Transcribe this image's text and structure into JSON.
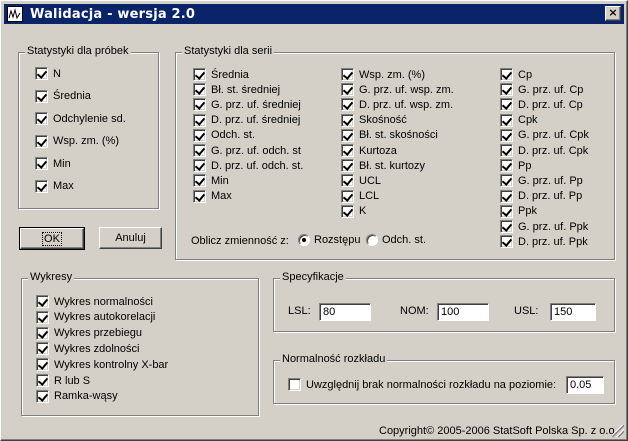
{
  "window": {
    "title": "Walidacja - wersja 2.0",
    "close_label": "×"
  },
  "sample_stats": {
    "legend": "Statystyki dla próbek",
    "items": [
      {
        "label": "N",
        "checked": true
      },
      {
        "label": "Średnia",
        "checked": true
      },
      {
        "label": "Odchylenie sd.",
        "checked": true
      },
      {
        "label": "Wsp. zm. (%)",
        "checked": true
      },
      {
        "label": "Min",
        "checked": true
      },
      {
        "label": "Max",
        "checked": true
      }
    ]
  },
  "series_stats": {
    "legend": "Statystyki dla serii",
    "col1": [
      {
        "label": "Średnia",
        "checked": true
      },
      {
        "label": "Bł. st. średniej",
        "checked": true
      },
      {
        "label": "G. prz. uf. średniej",
        "checked": true
      },
      {
        "label": "D. prz. uf. średniej",
        "checked": true
      },
      {
        "label": "Odch. st.",
        "checked": true
      },
      {
        "label": "G. prz. uf. odch. st",
        "checked": true
      },
      {
        "label": "D. prz. uf. odch. st.",
        "checked": true
      },
      {
        "label": "Min",
        "checked": true
      },
      {
        "label": "Max",
        "checked": true
      }
    ],
    "col2": [
      {
        "label": "Wsp. zm. (%)",
        "checked": true
      },
      {
        "label": "G. prz. uf. wsp. zm.",
        "checked": true
      },
      {
        "label": "D. prz. uf. wsp. zm.",
        "checked": true
      },
      {
        "label": "Skośność",
        "checked": true
      },
      {
        "label": "Bł. st. skośności",
        "checked": true
      },
      {
        "label": "Kurtoza",
        "checked": true
      },
      {
        "label": "Bł. st. kurtozy",
        "checked": true
      },
      {
        "label": "UCL",
        "checked": true
      },
      {
        "label": "LCL",
        "checked": true
      },
      {
        "label": "K",
        "checked": true
      }
    ],
    "col3": [
      {
        "label": "Cp",
        "checked": true
      },
      {
        "label": "G. prz. uf. Cp",
        "checked": true
      },
      {
        "label": "D. prz. uf. Cp",
        "checked": true
      },
      {
        "label": "Cpk",
        "checked": true
      },
      {
        "label": "G. prz. uf. Cpk",
        "checked": true
      },
      {
        "label": "D. prz. uf. Cpk",
        "checked": true
      },
      {
        "label": "Pp",
        "checked": true
      },
      {
        "label": "G. prz. uf. Pp",
        "checked": true
      },
      {
        "label": "D. prz. uf. Pp",
        "checked": true
      },
      {
        "label": "Ppk",
        "checked": true
      },
      {
        "label": "G. prz. uf. Ppk",
        "checked": true
      },
      {
        "label": "D. prz. uf. Ppk",
        "checked": true
      }
    ],
    "variability_label": "Oblicz zmienność z:",
    "variability_options": [
      {
        "label": "Rozstępu",
        "selected": true
      },
      {
        "label": "Odch. st.",
        "selected": false
      }
    ]
  },
  "buttons": {
    "ok": "OK",
    "cancel": "Anuluj"
  },
  "charts": {
    "legend": "Wykresy",
    "items": [
      {
        "label": "Wykres normalności",
        "checked": true
      },
      {
        "label": "Wykres autokorelacji",
        "checked": true
      },
      {
        "label": "Wykres przebiegu",
        "checked": true
      },
      {
        "label": "Wykres zdolności",
        "checked": true
      },
      {
        "label": "Wykres kontrolny X-bar",
        "checked": true
      },
      {
        "label": "R lub S",
        "checked": true
      },
      {
        "label": "Ramka-wąsy",
        "checked": true
      }
    ]
  },
  "specification": {
    "legend": "Specyfikacje",
    "lsl_label": "LSL:",
    "lsl_value": "80",
    "nom_label": "NOM:",
    "nom_value": "100",
    "usl_label": "USL:",
    "usl_value": "150"
  },
  "normality": {
    "legend": "Normalność rozkładu",
    "checkbox_label": "Uwzględnij brak normalności rozkładu na poziomie:",
    "checked": false,
    "level_value": "0.05"
  },
  "footer": {
    "copyright": "Copyright© 2005-2006 StatSoft Polska Sp. z o.o."
  }
}
